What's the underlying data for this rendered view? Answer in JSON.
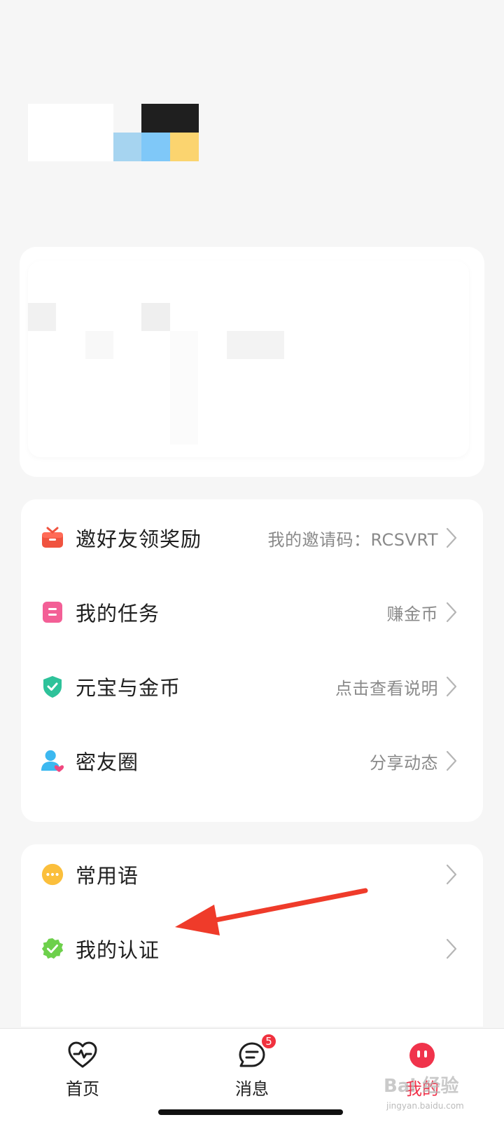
{
  "menu_group_1": [
    {
      "label": "邀好友领奖励",
      "detail": "我的邀请码：RCSVRT",
      "icon": "gift-icon"
    },
    {
      "label": "我的任务",
      "detail": "赚金币",
      "icon": "task-icon"
    },
    {
      "label": "元宝与金币",
      "detail": "点击查看说明",
      "icon": "shield-check-icon"
    },
    {
      "label": "密友圈",
      "detail": "分享动态",
      "icon": "friend-circle-icon"
    }
  ],
  "menu_group_2": [
    {
      "label": "常用语",
      "detail": "",
      "icon": "chat-phrases-icon"
    },
    {
      "label": "我的认证",
      "detail": "",
      "icon": "verified-badge-icon"
    }
  ],
  "tabbar": {
    "tabs": [
      {
        "label": "首页",
        "icon": "heart-pulse-icon"
      },
      {
        "label": "消息",
        "icon": "message-icon",
        "badge": "5"
      },
      {
        "label": "我的",
        "icon": "profile-face-icon",
        "active": true
      }
    ]
  },
  "watermark": {
    "text": "Bai 经验",
    "sub": "jingyan.baidu.com"
  },
  "colors": {
    "accent": "#f0313e",
    "background": "#f6f6f6",
    "card": "#ffffff"
  }
}
